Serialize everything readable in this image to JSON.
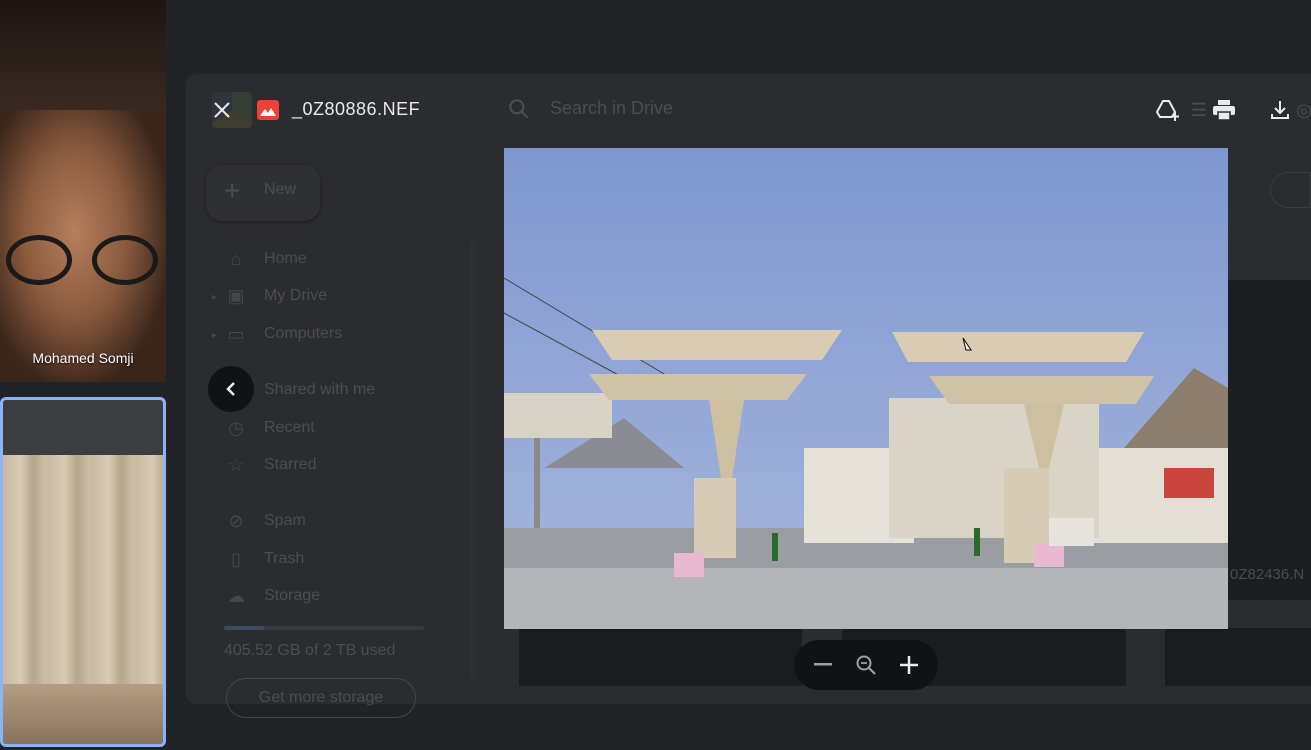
{
  "meeting": {
    "participants": [
      {
        "name": "Mohamed Somji"
      }
    ]
  },
  "drive": {
    "new_label": "New",
    "search_placeholder": "Search in Drive",
    "nav": [
      {
        "label": "Home",
        "icon": "home-icon"
      },
      {
        "label": "My Drive",
        "icon": "my-drive-icon"
      },
      {
        "label": "Computers",
        "icon": "computers-icon"
      },
      {
        "label": "Shared with me",
        "icon": "shared-icon"
      },
      {
        "label": "Recent",
        "icon": "clock-icon"
      },
      {
        "label": "Starred",
        "icon": "star-icon"
      },
      {
        "label": "Spam",
        "icon": "spam-icon"
      },
      {
        "label": "Trash",
        "icon": "trash-icon"
      },
      {
        "label": "Storage",
        "icon": "cloud-icon"
      }
    ],
    "storage": {
      "used_text": "405.52 GB of 2 TB used",
      "used_fraction": 0.2,
      "get_more_label": "Get more storage"
    },
    "background_file_name": "0Z82436.N"
  },
  "viewer": {
    "file_name": "_0Z80886.NEF",
    "header_icons": [
      "add-to-drive-icon",
      "print-icon",
      "download-icon"
    ],
    "zoom_controls": [
      "zoom-out-icon",
      "zoom-reset-icon",
      "zoom-in-icon"
    ],
    "colors": {
      "file_icon": "#ea4335",
      "active_tile_border": "#8ab4f8"
    }
  }
}
